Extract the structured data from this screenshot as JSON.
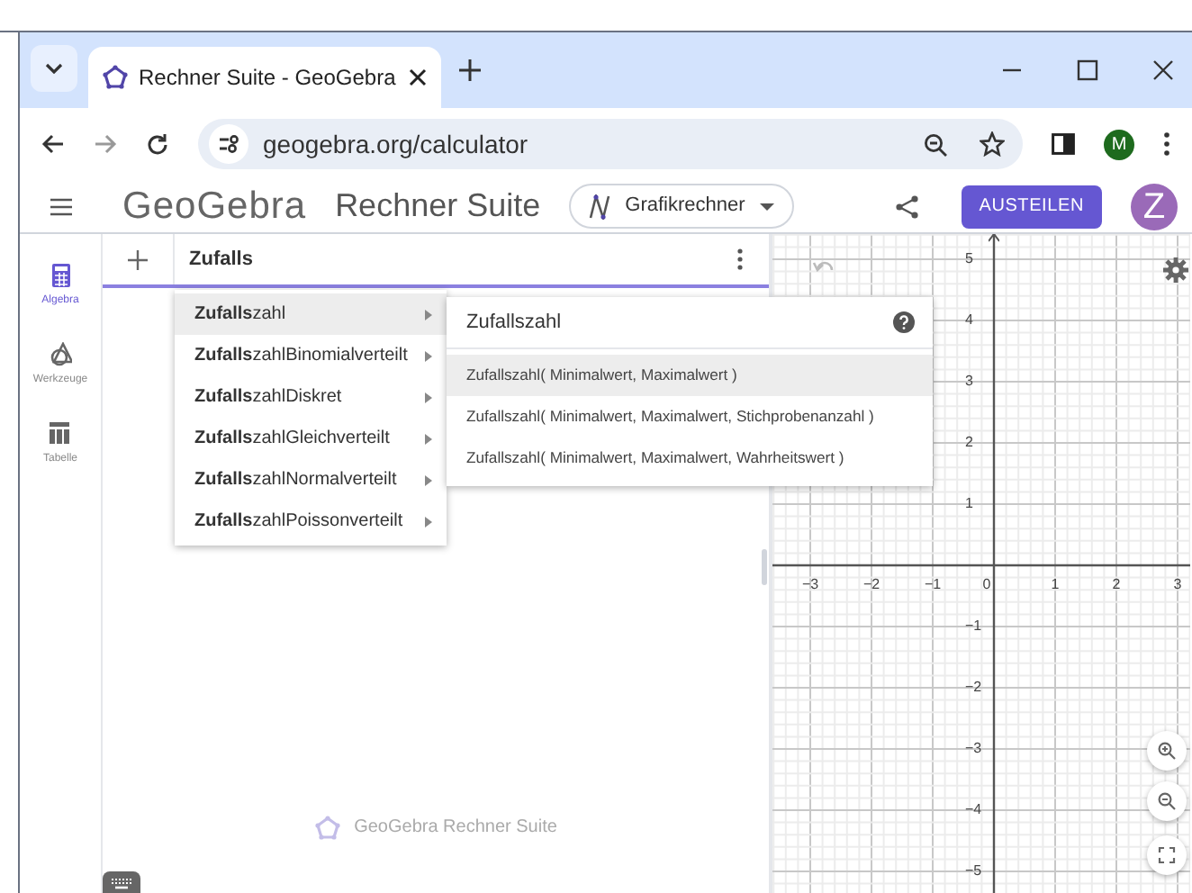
{
  "browser": {
    "tab_title": "Rechner Suite - GeoGebra",
    "url": "geogebra.org/calculator",
    "profile": "M"
  },
  "header": {
    "logo": "GeoGebra",
    "suite": "Rechner Suite",
    "app": "Grafikrechner",
    "share_button": "AUSTEILEN",
    "avatar": "Z"
  },
  "sidebar": {
    "items": [
      {
        "label": "Algebra",
        "kind": "calculator",
        "selected": true
      },
      {
        "label": "Werkzeuge",
        "kind": "tools",
        "selected": false
      },
      {
        "label": "Tabelle",
        "kind": "table",
        "selected": false
      }
    ]
  },
  "algebra": {
    "input": "Zufalls",
    "suggestions": [
      {
        "label": "**Zufalls**zahl",
        "selected": true
      },
      {
        "label": "**Zufalls**zahlBinomialverteilt",
        "selected": false
      },
      {
        "label": "**Zufalls**zahlDiskret",
        "selected": false
      },
      {
        "label": "**Zufalls**zahlGleichverteilt",
        "selected": false
      },
      {
        "label": "**Zufalls**zahlNormalverteilt",
        "selected": false
      },
      {
        "label": "**Zufalls**zahlPoissonverteilt",
        "selected": false
      }
    ],
    "submenu": {
      "title": "Zufallszahl",
      "syntaxes": [
        {
          "label": "Zufallszahl( Minimalwert, Maximalwert )",
          "selected": true
        },
        {
          "label": "Zufallszahl( Minimalwert, Maximalwert, Stichprobenanzahl )",
          "selected": false
        },
        {
          "label": "Zufallszahl( Minimalwert, Maximalwert, Wahrheitswert )",
          "selected": false
        }
      ]
    },
    "footer": "GeoGebra Rechner Suite"
  },
  "graph": {
    "x_labels": [
      "−3",
      "−2",
      "−1",
      "0",
      "1",
      "2",
      "3"
    ],
    "y_labels": [
      "5",
      "4",
      "3",
      "2",
      "1",
      "−1",
      "−2",
      "−3",
      "−4",
      "−5"
    ]
  }
}
